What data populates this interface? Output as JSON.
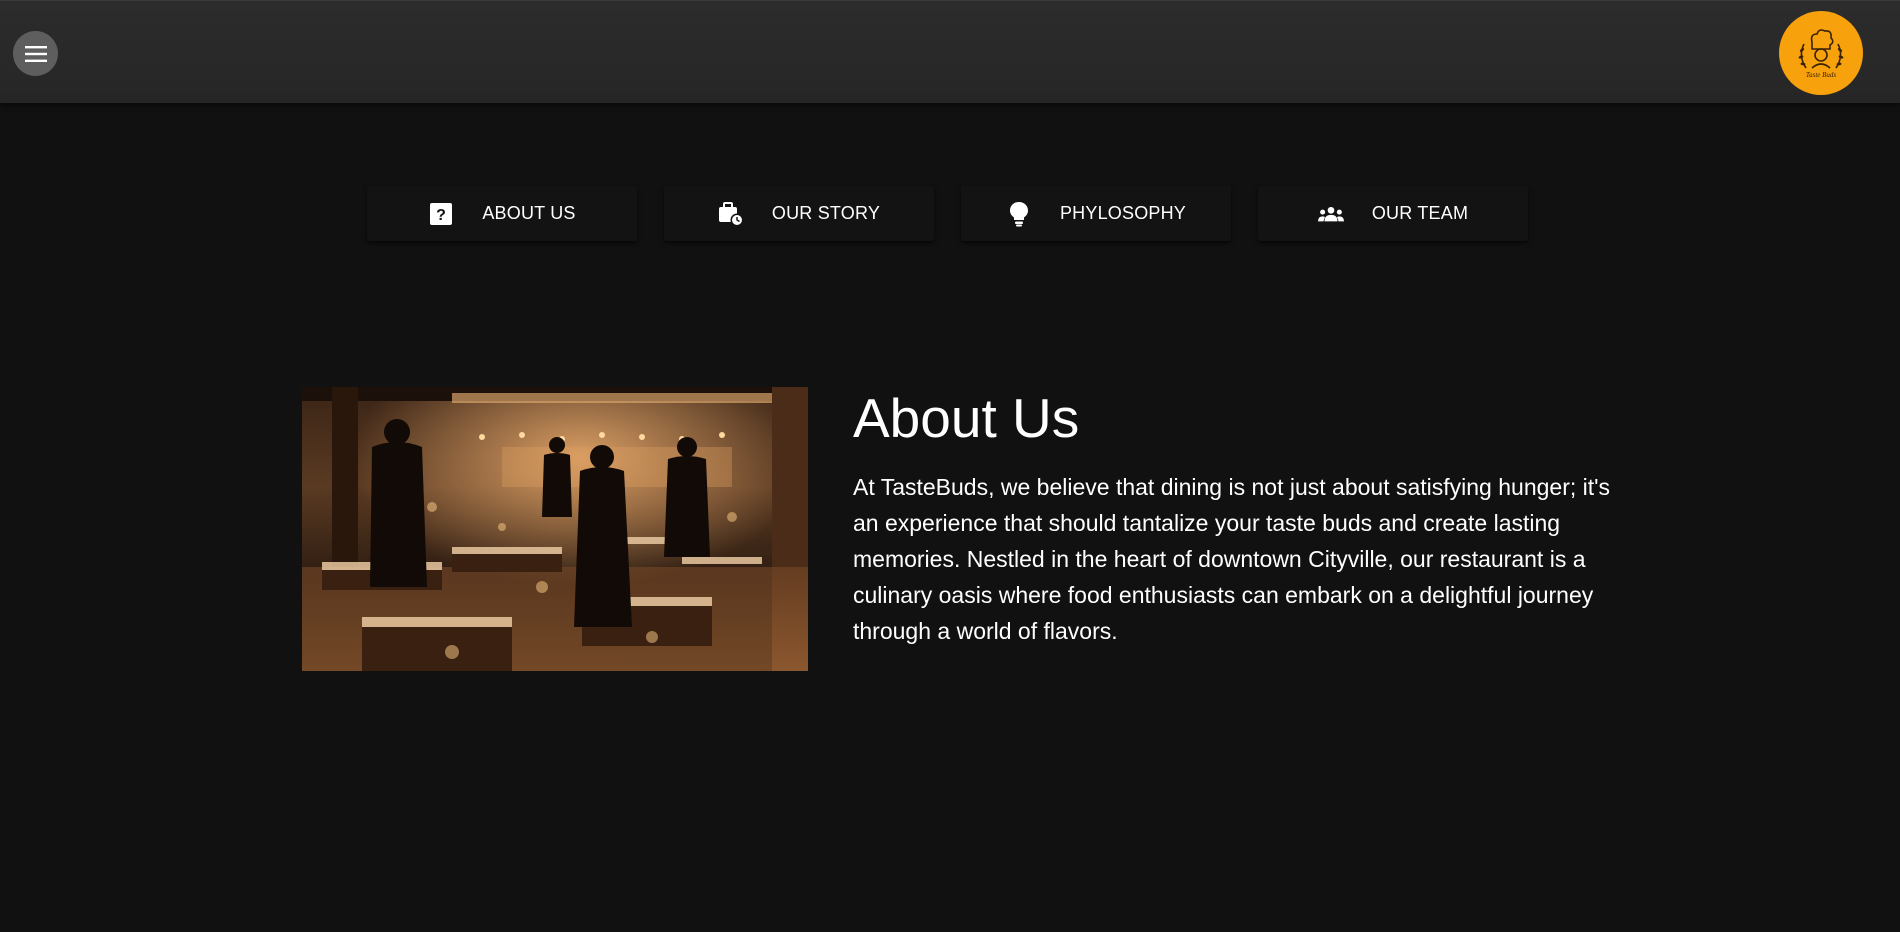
{
  "header": {
    "menu_icon": "hamburger-menu-icon",
    "logo_text": "Taste Buds",
    "logo_color": "#f7a10c"
  },
  "tabs": [
    {
      "label": "ABOUT US",
      "icon": "question-box-icon"
    },
    {
      "label": "OUR STORY",
      "icon": "briefcase-clock-icon"
    },
    {
      "label": "PHYLOSOPHY",
      "icon": "lightbulb-icon"
    },
    {
      "label": "OUR TEAM",
      "icon": "group-icon"
    }
  ],
  "about": {
    "title": "About Us",
    "body": "At TasteBuds, we believe that dining is not just about satisfying hunger; it's an experience that should tantalize your taste buds and create lasting memories. Nestled in the heart of downtown Cityville, our restaurant is a culinary oasis where food enthusiasts can embark on a delightful journey through a world of flavors.",
    "image": "restaurant-interior-photo"
  }
}
